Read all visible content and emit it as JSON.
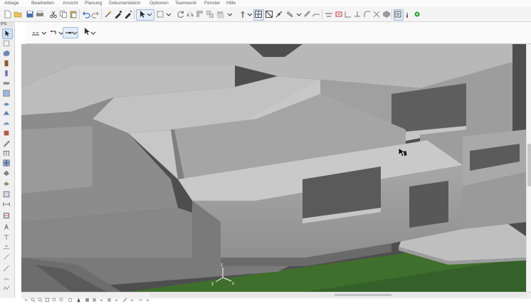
{
  "app": {
    "menu": [
      "Ablage",
      "Bearbeiten",
      "Ansicht",
      "Planung",
      "Dokumentation",
      "Optionen",
      "Teamwork",
      "Fenster",
      "Hilfe"
    ]
  },
  "toolbox": {
    "header": "IPG"
  },
  "viewport": {
    "axes": {
      "x": "x",
      "y": "y",
      "z": "z"
    }
  },
  "colors": {
    "concrete": "#b9b9b9",
    "grass": "#3e6e2c",
    "sky": "#4c4c4c",
    "accent": "#2d6fc3"
  }
}
